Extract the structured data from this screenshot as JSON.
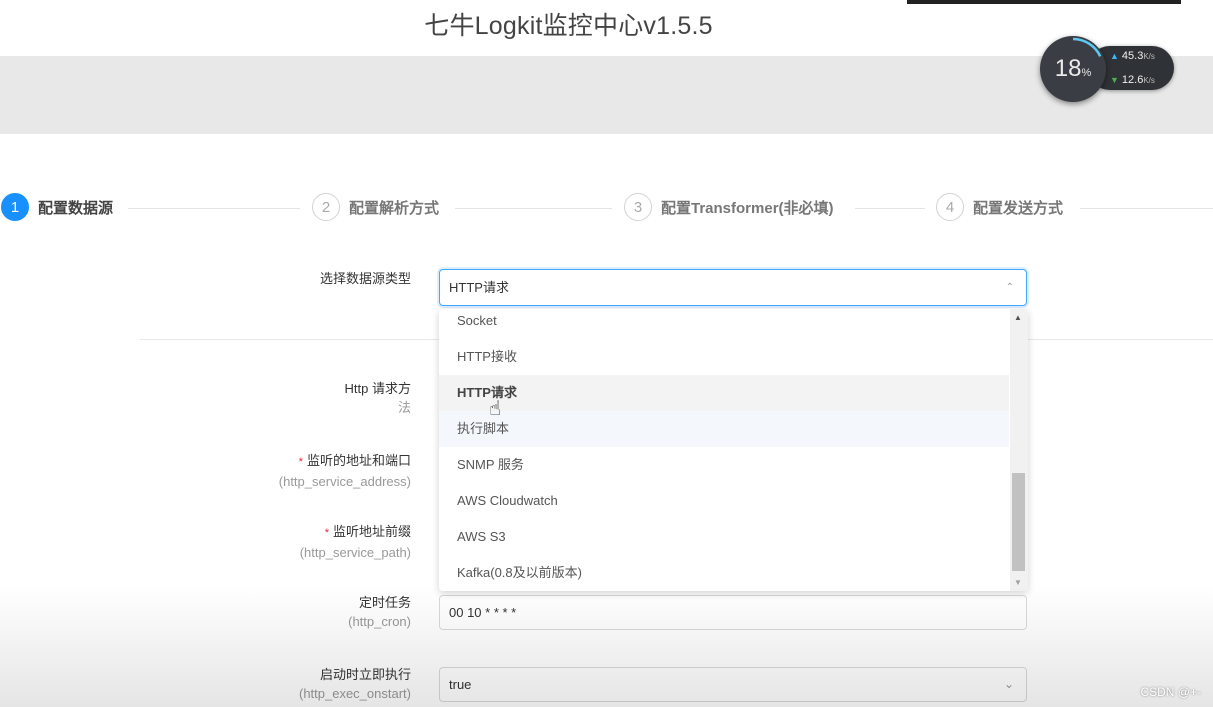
{
  "app": {
    "title": "七牛Logkit监控中心v1.5.5"
  },
  "net_monitor": {
    "percent": "18",
    "percent_unit": "%",
    "upload": "45.3",
    "download": "12.6",
    "unit": "K/s"
  },
  "steps": [
    {
      "number": "1",
      "label": "配置数据源",
      "active": true
    },
    {
      "number": "2",
      "label": "配置解析方式",
      "active": false
    },
    {
      "number": "3",
      "label": "配置Transformer(非必填)",
      "active": false
    },
    {
      "number": "4",
      "label": "配置发送方式",
      "active": false
    }
  ],
  "form": {
    "source_type_label": "选择数据源类型",
    "source_type_value": "HTTP请求",
    "http_method_label": "Http 请求方",
    "http_method_label_sub": "法",
    "service_address_label": "监听的地址和端口",
    "service_address_sub": "(http_service_address)",
    "service_path_label": "监听地址前缀",
    "service_path_sub": "(http_service_path)",
    "cron_label": "定时任务",
    "cron_sub": "(http_cron)",
    "cron_value": "00 10 * * * *",
    "exec_onstart_label": "启动时立即执行",
    "exec_onstart_sub": "(http_exec_onstart)",
    "exec_onstart_value": "true"
  },
  "dropdown": {
    "options": [
      "Socket",
      "HTTP接收",
      "HTTP请求",
      "执行脚本",
      "SNMP 服务",
      "AWS Cloudwatch",
      "AWS S3",
      "Kafka(0.8及以前版本)"
    ],
    "selected": "HTTP请求"
  },
  "watermark": "CSDN @+-"
}
